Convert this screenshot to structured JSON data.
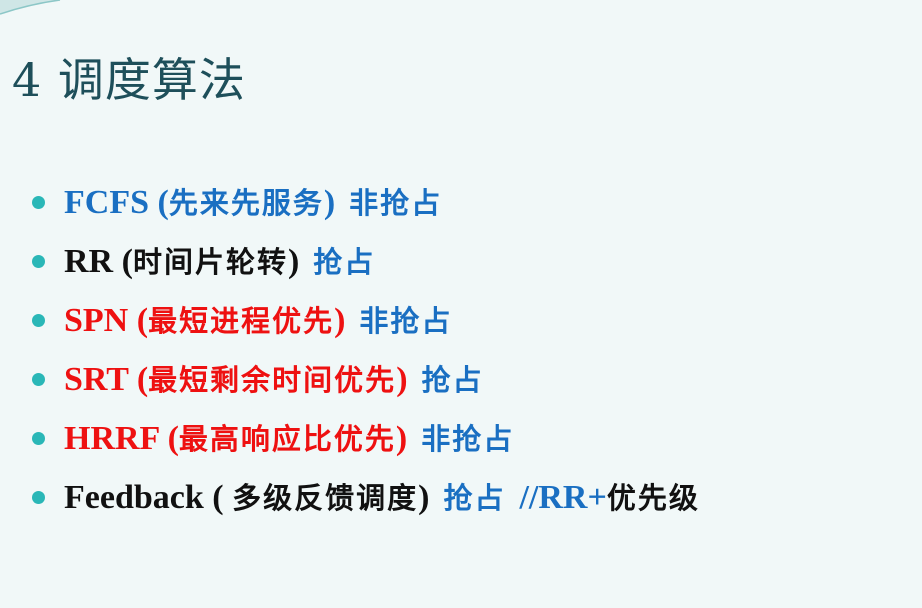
{
  "title": "4 调度算法",
  "items": [
    {
      "name": "FCFS",
      "paren_open": " (",
      "desc": "先来先服务",
      "paren_close": ")",
      "mode": "非抢占",
      "note": ""
    },
    {
      "name": "RR",
      "paren_open": " (",
      "desc": "时间片轮转",
      "paren_close": ")",
      "mode": "抢占",
      "note": ""
    },
    {
      "name": "SPN",
      "paren_open": " (",
      "desc": "最短进程优先",
      "paren_close": ")",
      "mode": "非抢占",
      "note": ""
    },
    {
      "name": "SRT",
      "paren_open": " (",
      "desc": "最短剩余时间优先",
      "paren_close": ")",
      "mode": "抢占",
      "note": ""
    },
    {
      "name": "HRRF",
      "paren_open": " (",
      "desc": "最高响应比优先",
      "paren_close": ")",
      "mode": "非抢占",
      "note": ""
    },
    {
      "name": "Feedback",
      "paren_open": " ( ",
      "desc": "多级反馈调度",
      "paren_close": ")",
      "mode": "抢占",
      "note_slash": "//RR+",
      "note": "优先级"
    }
  ],
  "colors": {
    "background": "#f1f8f8",
    "title": "#1e4f5a",
    "bullet": "#2ab7b7",
    "blue": "#1a6fc2",
    "red": "#ee1111",
    "black": "#111111"
  }
}
